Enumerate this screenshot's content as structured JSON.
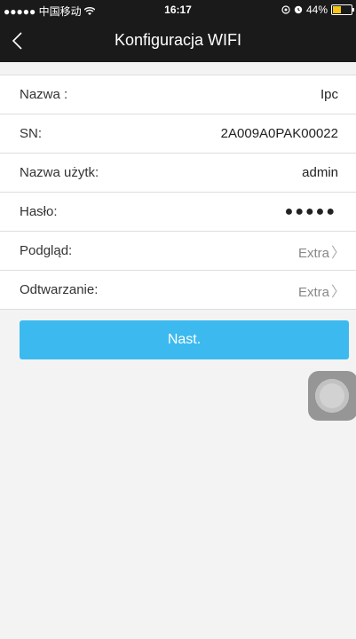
{
  "status_bar": {
    "carrier": "●●●●● 中国移动 ",
    "time": "16:17",
    "battery": "44%",
    "battery_level": 0.44
  },
  "header": {
    "title": "Konfiguracja WIFI"
  },
  "fields": [
    {
      "label": "Nazwa :",
      "value": "Ipc"
    },
    {
      "label": "SN:",
      "value": "2A009A0PAK00022"
    },
    {
      "label": "Nazwa użytk:",
      "value": "admin"
    },
    {
      "label": "Hasło:",
      "value": "●●●●●"
    },
    {
      "label": "Podgląd:",
      "value": "Extra"
    },
    {
      "label": "Odtwarzanie:",
      "value": "Extra"
    }
  ],
  "actions": {
    "next_label": "Nast."
  },
  "colors": {
    "accent": "#3cbaf0",
    "header_bg": "#1a1a1a",
    "battery_fill": "#f5c518"
  },
  "icons": [
    "back-chevron-icon",
    "wifi-icon",
    "location-icon",
    "alarm-icon",
    "battery-icon",
    "chevron-right-icon",
    "assistive-touch-icon"
  ]
}
